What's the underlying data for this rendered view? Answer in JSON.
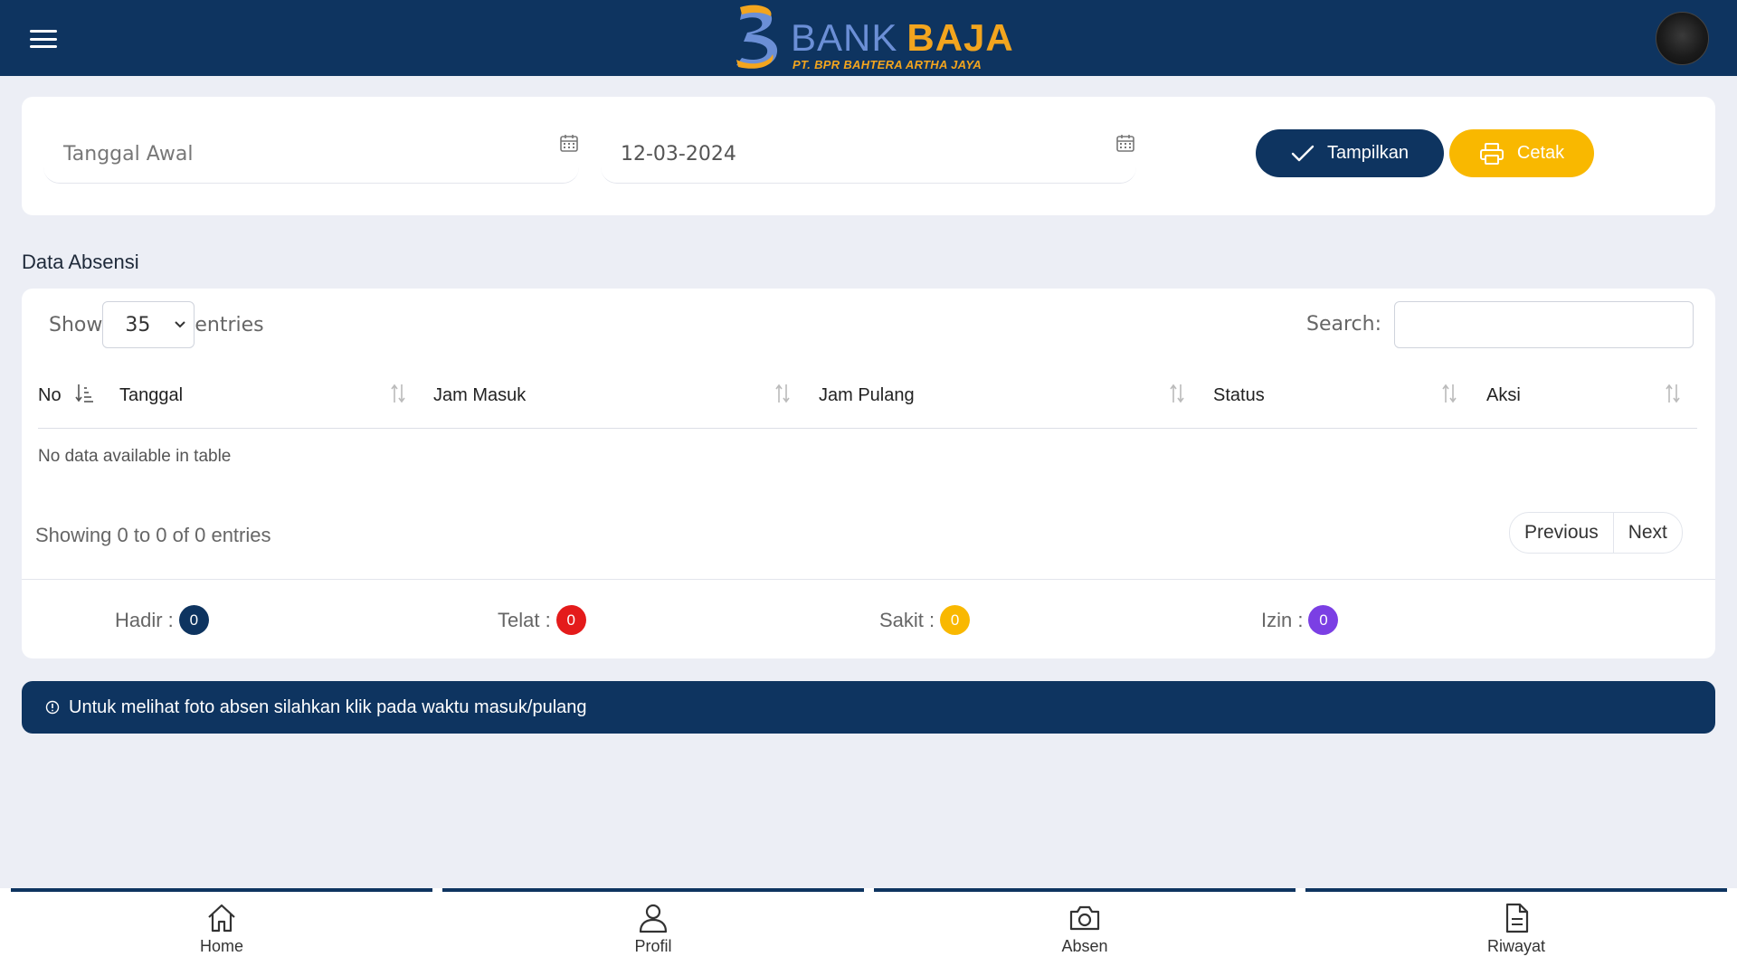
{
  "header": {
    "brand_main_1": "BANK",
    "brand_main_2": "BAJA",
    "brand_sub": "PT. BPR BAHTERA ARTHA JAYA",
    "brand_color_primary": "#0e3460",
    "brand_color_accent": "#f3a51e"
  },
  "filter": {
    "start_date_placeholder": "Tanggal Awal",
    "start_date_value": "",
    "end_date_value": "12-03-2024",
    "calendar_icon": "calendar-icon",
    "tampilkan_label": "Tampilkan",
    "cetak_label": "Cetak"
  },
  "section_title": "Data Absensi",
  "table": {
    "show_label": "Show",
    "page_size": "35",
    "entries_label": "entries",
    "search_label": "Search:",
    "search_value": "",
    "columns": [
      "No",
      "Tanggal",
      "Jam Masuk",
      "Jam Pulang",
      "Status",
      "Aksi"
    ],
    "rows": [],
    "empty_message": "No data available in table",
    "showing_text": "Showing 0 to 0 of 0 entries",
    "previous_label": "Previous",
    "next_label": "Next"
  },
  "summary": {
    "hadir_label": "Hadir :",
    "hadir_count": "0",
    "hadir_color": "#0e3460",
    "telat_label": "Telat :",
    "telat_count": "0",
    "telat_color": "#e41b1b",
    "sakit_label": "Sakit :",
    "sakit_count": "0",
    "sakit_color": "#f9b800",
    "izin_label": "Izin :",
    "izin_count": "0",
    "izin_color": "#7b3fe4"
  },
  "info_message": "Untuk melihat foto absen silahkan klik pada waktu masuk/pulang",
  "bottom_nav": [
    {
      "label": "Home",
      "icon": "home-icon"
    },
    {
      "label": "Profil",
      "icon": "user-icon"
    },
    {
      "label": "Absen",
      "icon": "camera-icon"
    },
    {
      "label": "Riwayat",
      "icon": "document-icon"
    }
  ]
}
